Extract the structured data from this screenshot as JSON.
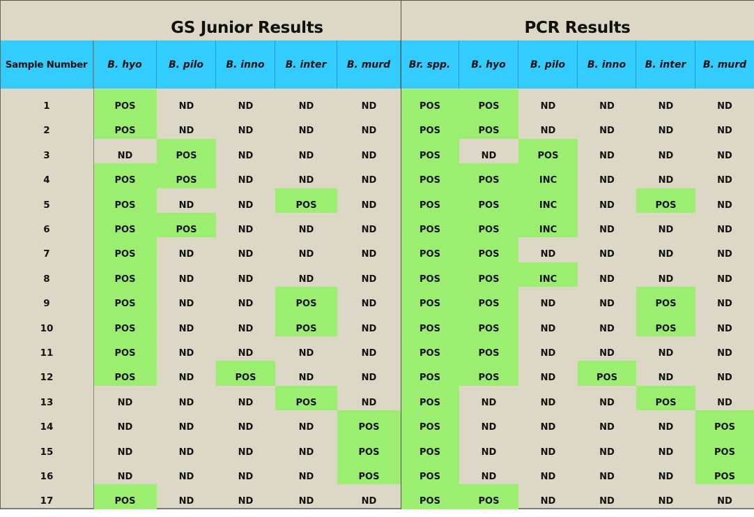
{
  "groups": {
    "gs_junior": "GS Junior Results",
    "pcr": "PCR Results"
  },
  "headers": {
    "sample": "Sample Number",
    "gs": [
      "B. hyo",
      "B. pilo",
      "B. inno",
      "B. inter",
      "B. murd"
    ],
    "pcr": [
      "Br. spp.",
      "B. hyo",
      "B. pilo",
      "B. inno",
      "B. inter",
      "B. murd"
    ]
  },
  "colors": {
    "header_bg": "#33ccff",
    "positive_bg": "#9cee70",
    "table_bg": "#ddd8c6"
  },
  "rows": [
    {
      "sample": "1",
      "gs": [
        "POS",
        "ND",
        "ND",
        "ND",
        "ND"
      ],
      "pcr": [
        "POS",
        "POS",
        "ND",
        "ND",
        "ND",
        "ND"
      ]
    },
    {
      "sample": "2",
      "gs": [
        "POS",
        "ND",
        "ND",
        "ND",
        "ND"
      ],
      "pcr": [
        "POS",
        "POS",
        "ND",
        "ND",
        "ND",
        "ND"
      ]
    },
    {
      "sample": "3",
      "gs": [
        "ND",
        "POS",
        "ND",
        "ND",
        "ND"
      ],
      "pcr": [
        "POS",
        "ND",
        "POS",
        "ND",
        "ND",
        "ND"
      ]
    },
    {
      "sample": "4",
      "gs": [
        "POS",
        "POS",
        "ND",
        "ND",
        "ND"
      ],
      "pcr": [
        "POS",
        "POS",
        "INC",
        "ND",
        "ND",
        "ND"
      ]
    },
    {
      "sample": "5",
      "gs": [
        "POS",
        "ND",
        "ND",
        "POS",
        "ND"
      ],
      "pcr": [
        "POS",
        "POS",
        "INC",
        "ND",
        "POS",
        "ND"
      ]
    },
    {
      "sample": "6",
      "gs": [
        "POS",
        "POS",
        "ND",
        "ND",
        "ND"
      ],
      "pcr": [
        "POS",
        "POS",
        "INC",
        "ND",
        "ND",
        "ND"
      ]
    },
    {
      "sample": "7",
      "gs": [
        "POS",
        "ND",
        "ND",
        "ND",
        "ND"
      ],
      "pcr": [
        "POS",
        "POS",
        "ND",
        "ND",
        "ND",
        "ND"
      ]
    },
    {
      "sample": "8",
      "gs": [
        "POS",
        "ND",
        "ND",
        "ND",
        "ND"
      ],
      "pcr": [
        "POS",
        "POS",
        "INC",
        "ND",
        "ND",
        "ND"
      ]
    },
    {
      "sample": "9",
      "gs": [
        "POS",
        "ND",
        "ND",
        "POS",
        "ND"
      ],
      "pcr": [
        "POS",
        "POS",
        "ND",
        "ND",
        "POS",
        "ND"
      ]
    },
    {
      "sample": "10",
      "gs": [
        "POS",
        "ND",
        "ND",
        "POS",
        "ND"
      ],
      "pcr": [
        "POS",
        "POS",
        "ND",
        "ND",
        "POS",
        "ND"
      ]
    },
    {
      "sample": "11",
      "gs": [
        "POS",
        "ND",
        "ND",
        "ND",
        "ND"
      ],
      "pcr": [
        "POS",
        "POS",
        "ND",
        "ND",
        "ND",
        "ND"
      ]
    },
    {
      "sample": "12",
      "gs": [
        "POS",
        "ND",
        "POS",
        "ND",
        "ND"
      ],
      "pcr": [
        "POS",
        "POS",
        "ND",
        "POS",
        "ND",
        "ND"
      ]
    },
    {
      "sample": "13",
      "gs": [
        "ND",
        "ND",
        "ND",
        "POS",
        "ND"
      ],
      "pcr": [
        "POS",
        "ND",
        "ND",
        "ND",
        "POS",
        "ND"
      ]
    },
    {
      "sample": "14",
      "gs": [
        "ND",
        "ND",
        "ND",
        "ND",
        "POS"
      ],
      "pcr": [
        "POS",
        "ND",
        "ND",
        "ND",
        "ND",
        "POS"
      ]
    },
    {
      "sample": "15",
      "gs": [
        "ND",
        "ND",
        "ND",
        "ND",
        "POS"
      ],
      "pcr": [
        "POS",
        "ND",
        "ND",
        "ND",
        "ND",
        "POS"
      ]
    },
    {
      "sample": "16",
      "gs": [
        "ND",
        "ND",
        "ND",
        "ND",
        "POS"
      ],
      "pcr": [
        "POS",
        "ND",
        "ND",
        "ND",
        "ND",
        "POS"
      ]
    },
    {
      "sample": "17",
      "gs": [
        "POS",
        "ND",
        "ND",
        "ND",
        "ND"
      ],
      "pcr": [
        "POS",
        "POS",
        "ND",
        "ND",
        "ND",
        "ND"
      ]
    }
  ]
}
